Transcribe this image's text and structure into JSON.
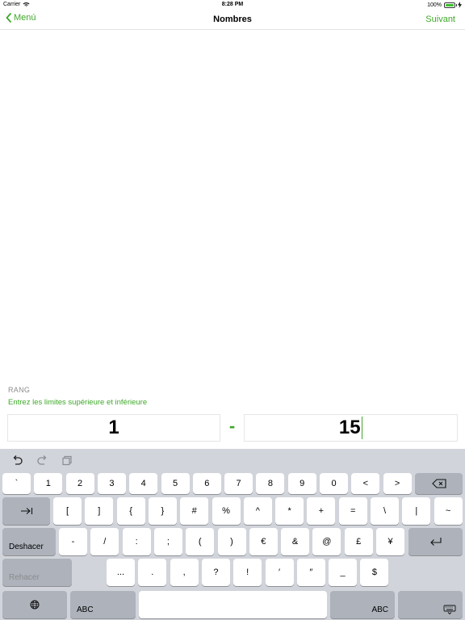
{
  "status_bar": {
    "carrier": "Carrier",
    "time": "8:28 PM",
    "battery": "100%",
    "battery_level": 1.0
  },
  "nav": {
    "back_label": "Menú",
    "title": "Nombres",
    "next_label": "Suivant"
  },
  "range": {
    "header": "RANG",
    "hint": "Entrez les limites supérieure et inférieure",
    "lower_value": "1",
    "separator": "-",
    "upper_value": "15"
  },
  "colors": {
    "accent": "#3fa829",
    "keyboard_bg": "#d1d4da",
    "key_dark": "#adb2bb"
  },
  "keyboard": {
    "toolbar_icons": [
      "undo-icon",
      "redo-icon",
      "paste-icon"
    ],
    "row1": [
      "`",
      "1",
      "2",
      "3",
      "4",
      "5",
      "6",
      "7",
      "8",
      "9",
      "0",
      "<",
      ">"
    ],
    "row2": [
      "[",
      "]",
      "{",
      "}",
      "#",
      "%",
      "^",
      "*",
      "+",
      "=",
      "\\",
      "|",
      "~"
    ],
    "row3": [
      "-",
      "/",
      ":",
      ";",
      "(",
      ")",
      "€",
      "&",
      "@",
      "£",
      "¥"
    ],
    "row4": [
      "...",
      ".",
      ",",
      "?",
      "!",
      "′",
      "″",
      "_",
      "$"
    ],
    "undo_label": "Deshacer",
    "redo_label": "Rehacer",
    "abc_label": "ABC"
  }
}
